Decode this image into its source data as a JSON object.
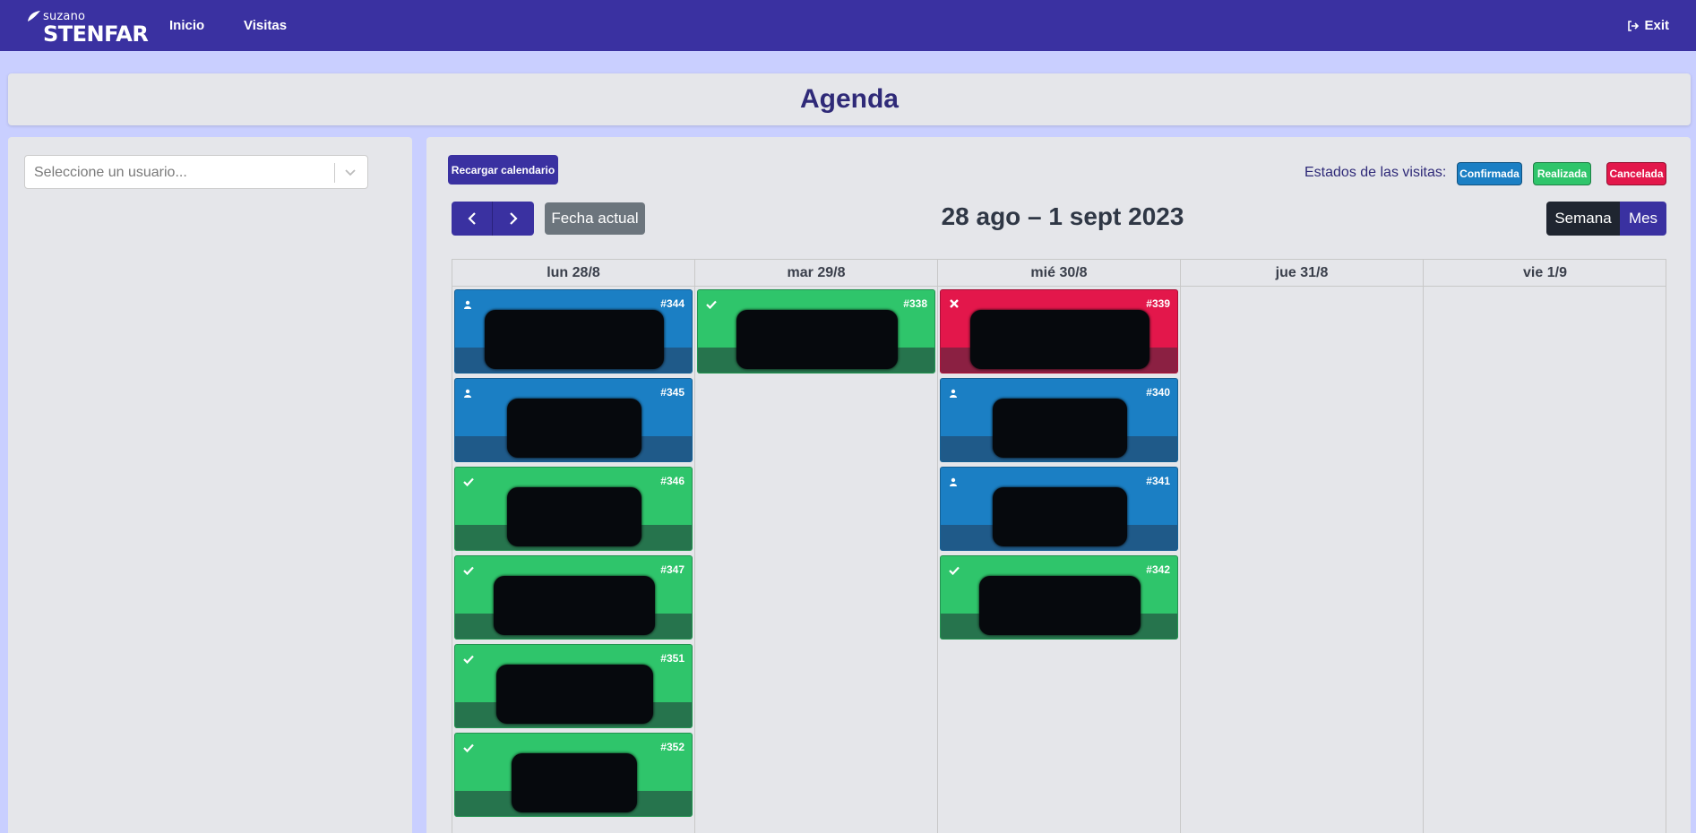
{
  "navbar": {
    "logo_small": "suzano",
    "logo_big": "STENFAR",
    "links": [
      "Inicio",
      "Visitas"
    ],
    "exit_label": "Exit"
  },
  "page_title": "Agenda",
  "sidebar": {
    "user_select_placeholder": "Seleccione un usuario..."
  },
  "toolbar": {
    "reload_label": "Recargar calendario",
    "estados_label": "Estados de las visitas:",
    "statuses": [
      {
        "label": "Confirmada",
        "color": "#1b7fc4"
      },
      {
        "label": "Realizada",
        "color": "#2fc56b"
      },
      {
        "label": "Cancelada",
        "color": "#e3174b"
      }
    ],
    "today_label": "Fecha actual",
    "range_title": "28 ago – 1 sept 2023",
    "views": [
      {
        "label": "Semana",
        "active": true
      },
      {
        "label": "Mes",
        "active": false
      }
    ]
  },
  "calendar": {
    "days": [
      {
        "label": "lun 28/8",
        "events": [
          {
            "num": "#344",
            "status": "confirmada",
            "icon": "user-icon"
          },
          {
            "num": "#345",
            "status": "confirmada",
            "icon": "user-icon"
          },
          {
            "num": "#346",
            "status": "realizada",
            "icon": "check-icon"
          },
          {
            "num": "#347",
            "status": "realizada",
            "icon": "check-icon"
          },
          {
            "num": "#351",
            "status": "realizada",
            "icon": "check-icon"
          },
          {
            "num": "#352",
            "status": "realizada",
            "icon": "check-icon"
          }
        ]
      },
      {
        "label": "mar 29/8",
        "events": [
          {
            "num": "#338",
            "status": "realizada",
            "icon": "check-icon"
          }
        ]
      },
      {
        "label": "mié 30/8",
        "events": [
          {
            "num": "#339",
            "status": "cancelada",
            "icon": "close-icon"
          },
          {
            "num": "#340",
            "status": "confirmada",
            "icon": "user-icon"
          },
          {
            "num": "#341",
            "status": "confirmada",
            "icon": "user-icon"
          },
          {
            "num": "#342",
            "status": "realizada",
            "icon": "check-icon"
          }
        ]
      },
      {
        "label": "jue 31/8",
        "events": []
      },
      {
        "label": "vie 1/9",
        "events": []
      }
    ]
  }
}
